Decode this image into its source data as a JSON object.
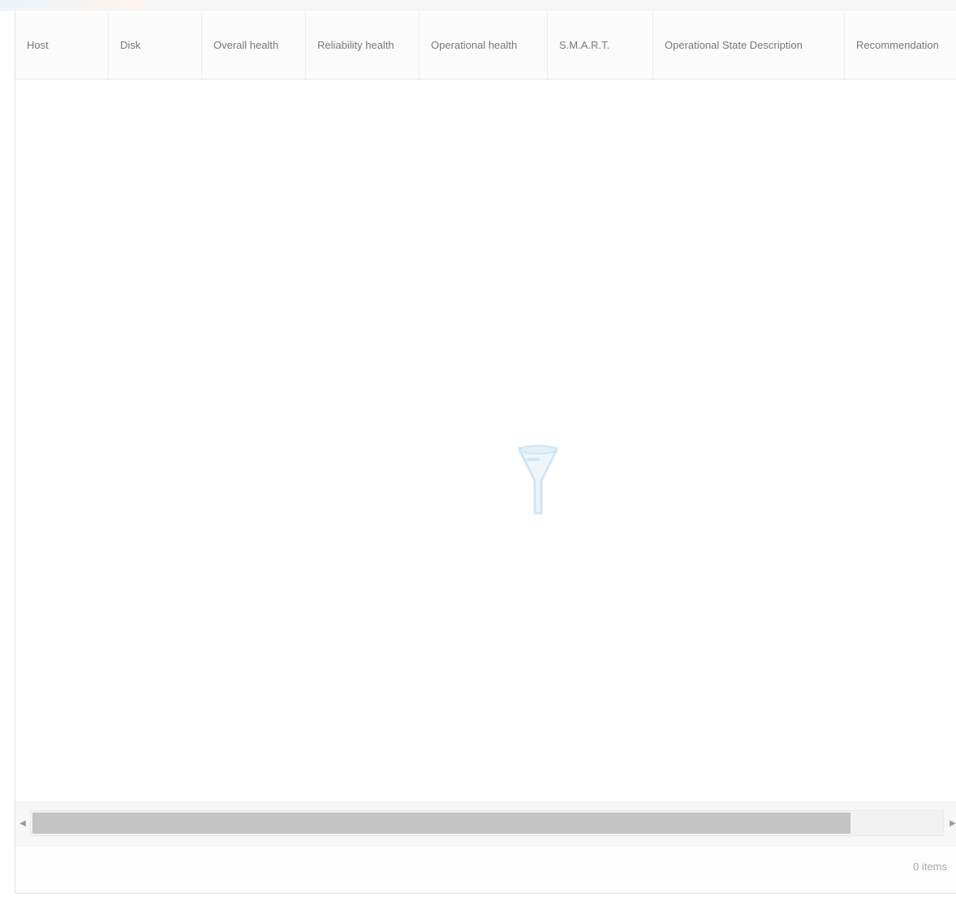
{
  "grid": {
    "columns": [
      {
        "label": "Host"
      },
      {
        "label": "Disk"
      },
      {
        "label": "Overall health"
      },
      {
        "label": "Reliability health"
      },
      {
        "label": "Operational health"
      },
      {
        "label": "S.M.A.R.T."
      },
      {
        "label": "Operational State Description"
      },
      {
        "label": "Recommendation"
      }
    ],
    "empty_text": "",
    "scroll_left_glyph": "◀",
    "scroll_right_glyph": "▶",
    "scroll_fraction_visible": 0.9
  },
  "footer": {
    "items_count": "0 items"
  },
  "icons": {
    "empty": "funnel-icon"
  },
  "colors": {
    "empty_icon": "#cfe6f2",
    "scroll_thumb": "#c4c4c4",
    "header_text": "#777777"
  }
}
